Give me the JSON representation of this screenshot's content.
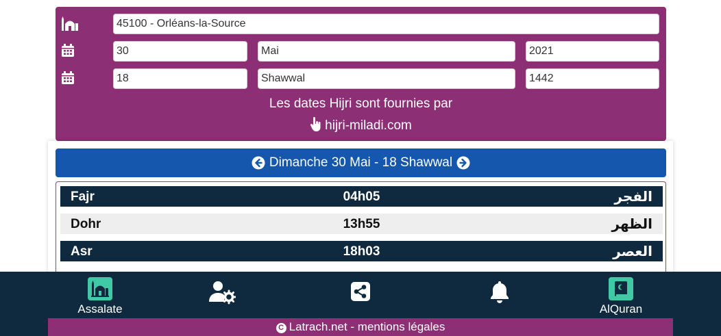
{
  "location": {
    "value": "45100 - Orléans-la-Source"
  },
  "gregorian": {
    "day": "30",
    "month": "Mai",
    "year": "2021"
  },
  "hijri": {
    "day": "18",
    "month": "Shawwal",
    "year": "1442"
  },
  "hijri_note": "Les dates Hijri sont fournies par",
  "hijri_link": "hijri-miladi.com",
  "day_title": "Dimanche 30 Mai - 18 Shawwal",
  "prayers": [
    {
      "name": "Fajr",
      "time": "04h05",
      "arabic": "الفجر"
    },
    {
      "name": "Dohr",
      "time": "13h55",
      "arabic": "الظهر"
    },
    {
      "name": "Asr",
      "time": "18h03",
      "arabic": "العصر"
    }
  ],
  "nav": {
    "assalate": "Assalate",
    "alquran": "AlQuran"
  },
  "footer": {
    "text": "Latrach.net - mentions légales"
  },
  "colors": {
    "form_bg": "#8d2f74",
    "day_bar": "#1557ad",
    "dark_row": "#0f2a3e",
    "nav_bg": "#0f2a3e",
    "accent": "#3fc9a5"
  },
  "icons": [
    "mosque-icon",
    "calendar-icon",
    "hand-pointer-icon",
    "arrow-left-circle-icon",
    "arrow-right-circle-icon",
    "user-settings-icon",
    "share-icon",
    "bell-icon",
    "quran-icon",
    "copyright-icon"
  ]
}
